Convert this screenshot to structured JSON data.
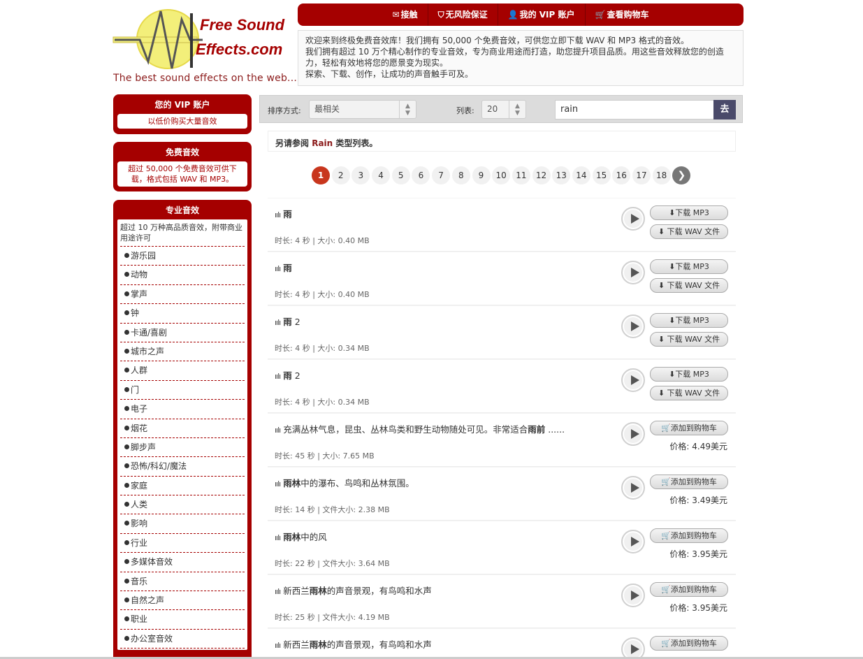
{
  "logo": {
    "line1": "Free Sound",
    "line2": "Effects.com",
    "tagline": "The best sound effects on the web..."
  },
  "topnav": {
    "items": [
      {
        "icon": "envelope-icon",
        "label": "接触"
      },
      {
        "icon": "shield-icon",
        "label": "无风险保证"
      },
      {
        "icon": "user-icon",
        "label": "我的 VIP 账户"
      },
      {
        "icon": "cart-icon",
        "label": "查看购物车"
      }
    ]
  },
  "intro": {
    "line1": "欢迎来到终极免费音效库！我们拥有 50,000 个免费音效，可供您立即下载 WAV 和 MP3 格式的音效。",
    "line2": "我们拥有超过 10 万个精心制作的专业音效，专为商业用途而打造，助您提升项目品质。用这些音效释放您的创造力，轻松有效地将您的愿景变为现实。",
    "line3": "探索、下载、创作，让成功的声音触手可及。"
  },
  "sidebar": {
    "vip": {
      "title": "您的 VIP 账户",
      "text": "以低价购买大量音效"
    },
    "free": {
      "title": "免费音效",
      "text": "超过 50,000 个免费音效可供下载，格式包括 WAV 和 MP3。"
    },
    "pro": {
      "title": "专业音效",
      "desc": "超过 10 万种高品质音效，附带商业用途许可",
      "categories": [
        "游乐园",
        "动物",
        "掌声",
        "钟",
        "卡通/喜剧",
        "城市之声",
        "人群",
        "门",
        "电子",
        "烟花",
        "脚步声",
        "恐怖/科幻/魔法",
        "家庭",
        "人类",
        "影响",
        "行业",
        "多媒体音效",
        "音乐",
        "自然之声",
        "职业",
        "办公室音效"
      ]
    }
  },
  "sortbar": {
    "sort_label": "排序方式:",
    "sort_value": "最相关",
    "list_label": "列表:",
    "list_value": "20",
    "search_value": "rain",
    "search_button": "去"
  },
  "seealso": {
    "prefix": "另请参阅",
    "term": "Rain",
    "suffix": "类型列表。"
  },
  "pager": {
    "pages": [
      "1",
      "2",
      "3",
      "4",
      "5",
      "6",
      "7",
      "8",
      "9",
      "10",
      "11",
      "12",
      "13",
      "14",
      "15",
      "16",
      "17",
      "18"
    ],
    "current": "1",
    "next": "❯"
  },
  "results": [
    {
      "pre": "",
      "bold": "雨",
      "post": "",
      "meta": "时长: 4 秒 | 大小: 0.40 MB",
      "type": "free",
      "btn1": "下载 MP3",
      "btn2": "下载 WAV 文件"
    },
    {
      "pre": "",
      "bold": "雨",
      "post": "",
      "meta": "时长: 4 秒 | 大小: 0.40 MB",
      "type": "free",
      "btn1": "下载 MP3",
      "btn2": "下载 WAV 文件"
    },
    {
      "pre": "",
      "bold": "雨",
      "post": " 2",
      "meta": "时长: 4 秒 | 大小: 0.34 MB",
      "type": "free",
      "btn1": "下载 MP3",
      "btn2": "下载 WAV 文件"
    },
    {
      "pre": "",
      "bold": "雨",
      "post": " 2",
      "meta": "时长: 4 秒 | 大小: 0.34 MB",
      "type": "free",
      "btn1": "下载 MP3",
      "btn2": "下载 WAV 文件"
    },
    {
      "pre": "充满丛林气息，昆虫、丛林鸟类和野生动物随处可见。非常适合",
      "bold": "雨前",
      "post": " ......",
      "meta": "时长: 45 秒 | 大小: 7.65 MB",
      "type": "pro",
      "btn1": "添加到购物车",
      "price": "价格: 4.49美元"
    },
    {
      "pre": "",
      "bold": "雨林",
      "post": "中的瀑布、鸟鸣和丛林氛围。",
      "meta": "时长: 14 秒 | 文件大小: 2.38 MB",
      "type": "pro",
      "btn1": "添加到购物车",
      "price": "价格: 3.49美元"
    },
    {
      "pre": "",
      "bold": "雨林",
      "post": "中的风",
      "meta": "时长: 22 秒 | 文件大小: 3.64 MB",
      "type": "pro",
      "btn1": "添加到购物车",
      "price": "价格: 3.95美元"
    },
    {
      "pre": "新西兰",
      "bold": "雨林",
      "post": "的声音景观，有鸟鸣和水声",
      "meta": "时长: 25 秒 | 文件大小: 4.19 MB",
      "type": "pro",
      "btn1": "添加到购物车",
      "price": "价格: 3.95美元"
    },
    {
      "pre": "新西兰",
      "bold": "雨林",
      "post": "的声音景观，有鸟鸣和水声",
      "meta": "",
      "type": "pro",
      "btn1": "添加到购物车",
      "price": ""
    }
  ],
  "colors": {
    "brand_red": "#a50000",
    "page_active": "#c8361d",
    "search_button": "#4a4a6a"
  }
}
